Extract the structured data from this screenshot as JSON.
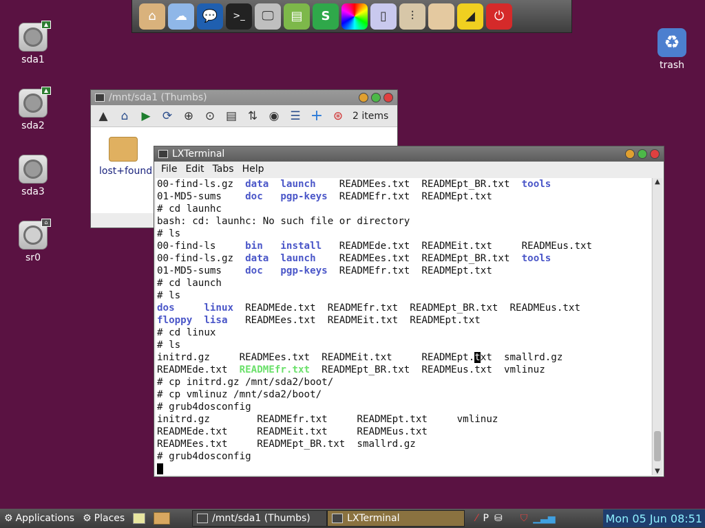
{
  "desktop": {
    "icons": [
      {
        "label": "sda1"
      },
      {
        "label": "sda2"
      },
      {
        "label": "sda3"
      },
      {
        "label": "sr0"
      }
    ],
    "trash_label": "trash"
  },
  "dock": {
    "items": [
      "home-folder",
      "cloud",
      "chat",
      "terminal",
      "monitor",
      "text-editor",
      "spreadsheet",
      "color-picker",
      "document",
      "settings",
      "blank",
      "brightness",
      "power"
    ]
  },
  "thumbs_window": {
    "title": "/mnt/sda1 (Thumbs)",
    "items_count": "2 items",
    "folder_label": "lost+found"
  },
  "terminal": {
    "title": "LXTerminal",
    "menu": [
      "File",
      "Edit",
      "Tabs",
      "Help"
    ],
    "lines": [
      [
        {
          "t": "00-find-ls.gz  "
        },
        {
          "t": "data",
          "c": "blue"
        },
        {
          "t": "  "
        },
        {
          "t": "launch",
          "c": "blue"
        },
        {
          "t": "    READMEes.txt  READMEpt_BR.txt  "
        },
        {
          "t": "tools",
          "c": "blue"
        }
      ],
      [
        {
          "t": "01-MD5-sums    "
        },
        {
          "t": "doc",
          "c": "blue"
        },
        {
          "t": "   "
        },
        {
          "t": "pgp-keys",
          "c": "blue"
        },
        {
          "t": "  READMEfr.txt  READMEpt.txt"
        }
      ],
      [
        {
          "t": "# cd launhc"
        }
      ],
      [
        {
          "t": "bash: cd: launhc: No such file or directory"
        }
      ],
      [
        {
          "t": "# ls"
        }
      ],
      [
        {
          "t": "00-find-ls     "
        },
        {
          "t": "bin",
          "c": "blue"
        },
        {
          "t": "   "
        },
        {
          "t": "install",
          "c": "blue"
        },
        {
          "t": "   READMEde.txt  READMEit.txt     READMEus.txt"
        }
      ],
      [
        {
          "t": "00-find-ls.gz  "
        },
        {
          "t": "data",
          "c": "blue"
        },
        {
          "t": "  "
        },
        {
          "t": "launch",
          "c": "blue"
        },
        {
          "t": "    READMEes.txt  READMEpt_BR.txt  "
        },
        {
          "t": "tools",
          "c": "blue"
        }
      ],
      [
        {
          "t": "01-MD5-sums    "
        },
        {
          "t": "doc",
          "c": "blue"
        },
        {
          "t": "   "
        },
        {
          "t": "pgp-keys",
          "c": "blue"
        },
        {
          "t": "  READMEfr.txt  READMEpt.txt"
        }
      ],
      [
        {
          "t": "# cd launch"
        }
      ],
      [
        {
          "t": "# ls"
        }
      ],
      [
        {
          "t": "dos",
          "c": "blue"
        },
        {
          "t": "     "
        },
        {
          "t": "linux",
          "c": "blue"
        },
        {
          "t": "  READMEde.txt  READMEfr.txt  READMEpt_BR.txt  READMEus.txt"
        }
      ],
      [
        {
          "t": "floppy",
          "c": "blue"
        },
        {
          "t": "  "
        },
        {
          "t": "lisa",
          "c": "blue"
        },
        {
          "t": "   READMEes.txt  READMEit.txt  READMEpt.txt"
        }
      ],
      [
        {
          "t": "# cd linux"
        }
      ],
      [
        {
          "t": "# ls"
        }
      ],
      [
        {
          "t": "initrd.gz     READMEes.txt  READMEit.txt     READMEpt."
        },
        {
          "t": "t",
          "c": "hl"
        },
        {
          "t": "xt  smallrd.gz"
        }
      ],
      [
        {
          "t": "READMEde.txt  "
        },
        {
          "t": "READMEfr.txt",
          "c": "green"
        },
        {
          "t": "  READMEpt_BR.txt  READMEus.txt  vmlinuz"
        }
      ],
      [
        {
          "t": "# cp initrd.gz /mnt/sda2/boot/"
        }
      ],
      [
        {
          "t": "# cp vmlinuz /mnt/sda2/boot/"
        }
      ],
      [
        {
          "t": "# grub4dosconfig"
        }
      ],
      [
        {
          "t": "initrd.gz        READMEfr.txt     READMEpt.txt     vmlinuz"
        }
      ],
      [
        {
          "t": "READMEde.txt     READMEit.txt     READMEus.txt"
        }
      ],
      [
        {
          "t": "READMEes.txt     READMEpt_BR.txt  smallrd.gz"
        }
      ],
      [
        {
          "t": "# grub4dosconfig"
        }
      ],
      [
        {
          "t": "",
          "c": "cursor"
        }
      ]
    ]
  },
  "taskbar": {
    "applications": "Applications",
    "places": "Places",
    "tasks": [
      "/mnt/sda1 (Thumbs)",
      "LXTerminal"
    ],
    "clock": "Mon 05 Jun 08:51"
  }
}
